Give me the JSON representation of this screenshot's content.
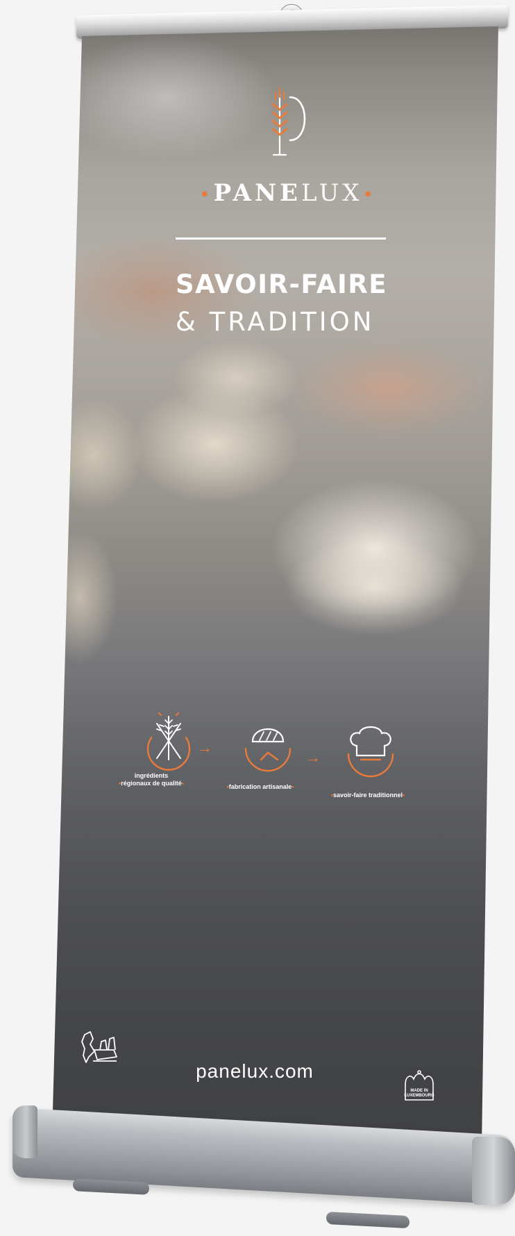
{
  "brand": {
    "name_bold": "PANE",
    "name_light": "LUX",
    "dot": "•",
    "accent_color": "#e87a3a"
  },
  "headline": {
    "line1": "SAVOIR-FAIRE",
    "line2": "& TRADITION"
  },
  "features": [
    {
      "icon": "wheat-icon",
      "caption_line1": "ingrédients",
      "caption_line2": "régionaux de qualité"
    },
    {
      "icon": "bread-clock-icon",
      "caption_line1": "fabrication artisanale",
      "caption_line2": ""
    },
    {
      "icon": "chef-hat-icon",
      "caption_line1": "savoir-faire traditionnel",
      "caption_line2": ""
    }
  ],
  "arrow": "→",
  "footer": {
    "url": "panelux.com",
    "left_icon": "map-luxembourg-icon",
    "badge_line1": "MADE IN",
    "badge_line2": "LUXEMBOURG"
  }
}
